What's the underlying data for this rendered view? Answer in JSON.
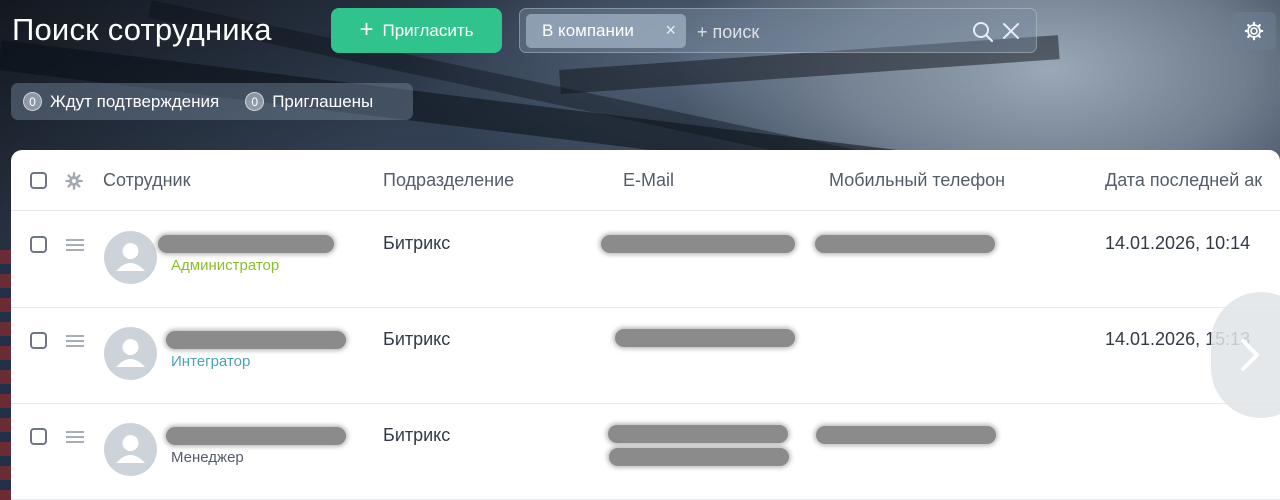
{
  "header": {
    "title": "Поиск сотрудника",
    "invite_label": "Пригласить"
  },
  "search": {
    "filter_chip": "В компании",
    "placeholder": "+ поиск"
  },
  "counters": [
    {
      "count": "0",
      "label": "Ждут подтверждения"
    },
    {
      "count": "0",
      "label": "Приглашены"
    }
  ],
  "table": {
    "columns": [
      "Сотрудник",
      "Подразделение",
      "E-Mail",
      "Мобильный телефон",
      "Дата последней ак"
    ],
    "rows": [
      {
        "role": "Администратор",
        "role_color": "#8bbf2a",
        "department": "Битрикс",
        "last_activity": "14.01.2026, 10:14"
      },
      {
        "role": "Интегратор",
        "role_color": "#4aa3b8",
        "department": "Битрикс",
        "last_activity": "14.01.2026, 15:13"
      },
      {
        "role": "Менеджер",
        "role_color": "#545c6a",
        "department": "Битрикс",
        "last_activity": ""
      }
    ]
  },
  "colors": {
    "accent_green": "#30c38d",
    "panel_bg": "#ffffff"
  },
  "icons": [
    "plus-icon",
    "close-icon",
    "search-icon",
    "gear-icon",
    "user-icon",
    "drag-handle-icon",
    "chevron-right-icon"
  ]
}
